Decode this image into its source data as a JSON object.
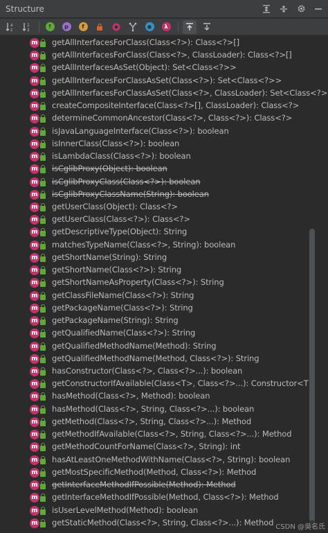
{
  "window": {
    "title": "Structure"
  },
  "toolbar": {
    "icons": [
      "sort-alpha-icon",
      "sort-visibility-icon",
      "show-inherited-icon",
      "show-properties-icon",
      "show-fields-icon",
      "show-non-public-icon",
      "show-anonymous-icon",
      "show-lambdas-icon",
      "show-lambda-icon",
      "autoscroll-to-source-icon",
      "autoscroll-from-source-icon"
    ]
  },
  "methods": [
    {
      "label": "getAllInterfacesForClass(Class<?>): Class<?>[]",
      "deprecated": false
    },
    {
      "label": "getAllInterfacesForClass(Class<?>, ClassLoader): Class<?>[]",
      "deprecated": false
    },
    {
      "label": "getAllInterfacesAsSet(Object): Set<Class<?>>",
      "deprecated": false
    },
    {
      "label": "getAllInterfacesForClassAsSet(Class<?>): Set<Class<?>>",
      "deprecated": false
    },
    {
      "label": "getAllInterfacesForClassAsSet(Class<?>, ClassLoader): Set<Class<?>>",
      "deprecated": false
    },
    {
      "label": "createCompositeInterface(Class<?>[], ClassLoader): Class<?>",
      "deprecated": false
    },
    {
      "label": "determineCommonAncestor(Class<?>, Class<?>): Class<?>",
      "deprecated": false
    },
    {
      "label": "isJavaLanguageInterface(Class<?>): boolean",
      "deprecated": false
    },
    {
      "label": "isInnerClass(Class<?>): boolean",
      "deprecated": false
    },
    {
      "label": "isLambdaClass(Class<?>): boolean",
      "deprecated": false
    },
    {
      "label": "isCglibProxy(Object): boolean",
      "deprecated": true
    },
    {
      "label": "isCglibProxyClass(Class<?>): boolean",
      "deprecated": true
    },
    {
      "label": "isCglibProxyClassName(String): boolean",
      "deprecated": true
    },
    {
      "label": "getUserClass(Object): Class<?>",
      "deprecated": false
    },
    {
      "label": "getUserClass(Class<?>): Class<?>",
      "deprecated": false
    },
    {
      "label": "getDescriptiveType(Object): String",
      "deprecated": false
    },
    {
      "label": "matchesTypeName(Class<?>, String): boolean",
      "deprecated": false
    },
    {
      "label": "getShortName(String): String",
      "deprecated": false
    },
    {
      "label": "getShortName(Class<?>): String",
      "deprecated": false
    },
    {
      "label": "getShortNameAsProperty(Class<?>): String",
      "deprecated": false
    },
    {
      "label": "getClassFileName(Class<?>): String",
      "deprecated": false
    },
    {
      "label": "getPackageName(Class<?>): String",
      "deprecated": false
    },
    {
      "label": "getPackageName(String): String",
      "deprecated": false
    },
    {
      "label": "getQualifiedName(Class<?>): String",
      "deprecated": false
    },
    {
      "label": "getQualifiedMethodName(Method): String",
      "deprecated": false
    },
    {
      "label": "getQualifiedMethodName(Method, Class<?>): String",
      "deprecated": false
    },
    {
      "label": "hasConstructor(Class<?>, Class<?>...): boolean",
      "deprecated": false
    },
    {
      "label": "getConstructorIfAvailable(Class<T>, Class<?>...): Constructor<T>",
      "deprecated": false
    },
    {
      "label": "hasMethod(Class<?>, Method): boolean",
      "deprecated": false
    },
    {
      "label": "hasMethod(Class<?>, String, Class<?>...): boolean",
      "deprecated": false
    },
    {
      "label": "getMethod(Class<?>, String, Class<?>...): Method",
      "deprecated": false
    },
    {
      "label": "getMethodIfAvailable(Class<?>, String, Class<?>...): Method",
      "deprecated": false
    },
    {
      "label": "getMethodCountForName(Class<?>, String): int",
      "deprecated": false
    },
    {
      "label": "hasAtLeastOneMethodWithName(Class<?>, String): boolean",
      "deprecated": false
    },
    {
      "label": "getMostSpecificMethod(Method, Class<?>): Method",
      "deprecated": false
    },
    {
      "label": "getInterfaceMethodIfPossible(Method): Method",
      "deprecated": true
    },
    {
      "label": "getInterfaceMethodIfPossible(Method, Class<?>): Method",
      "deprecated": false
    },
    {
      "label": "isUserLevelMethod(Method): boolean",
      "deprecated": false
    },
    {
      "label": "getStaticMethod(Class<?>, String, Class<?>...): Method",
      "deprecated": false
    }
  ],
  "method_icon_letter": "m",
  "colors": {
    "method_icon": "#c2336b",
    "lock": "#5fa93b",
    "text": "#bbbbbb",
    "background": "#2b2b2b",
    "header": "#3c3f41"
  },
  "watermark": "CSDN @吳名氏"
}
